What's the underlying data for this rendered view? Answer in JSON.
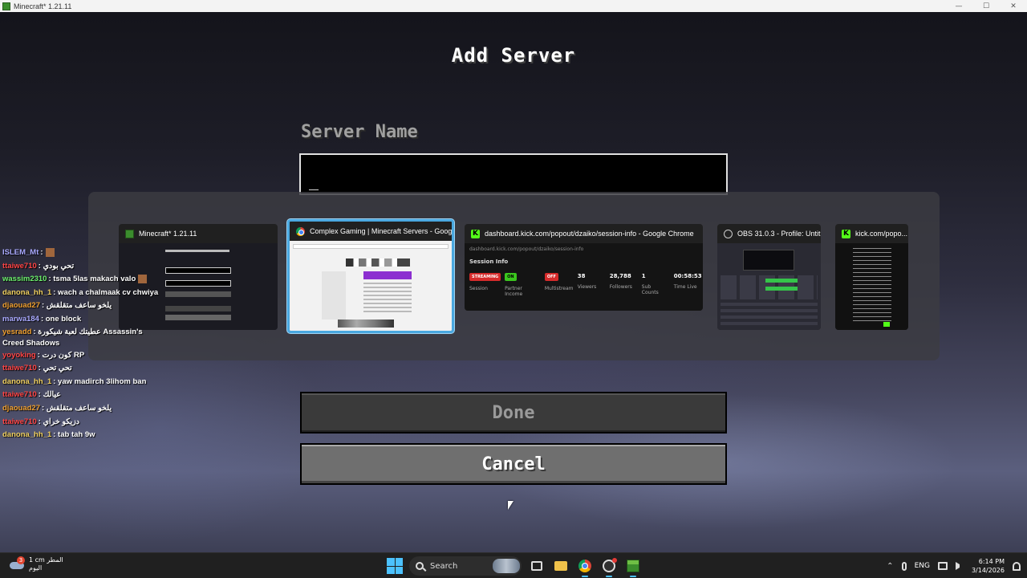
{
  "window": {
    "title": "Minecraft* 1.21.11",
    "controls": [
      "—",
      "☐",
      "✕"
    ]
  },
  "screen": {
    "title": "Add Server",
    "server_name_label": "Server Name",
    "server_name_value": "_",
    "done_label": "Done",
    "cancel_label": "Cancel"
  },
  "switcher": {
    "windows": [
      {
        "label": "Minecraft* 1.21.11",
        "icon": "minecraft-icon"
      },
      {
        "label": "Complex Gaming | Minecraft Servers - Googl...",
        "icon": "chrome-icon",
        "selected": true
      },
      {
        "label": "dashboard.kick.com/popout/dzaiko/session-info - Google Chrome",
        "icon": "kick-icon"
      },
      {
        "label": "OBS 31.0.3 - Profile: Untitl...",
        "icon": "obs-icon"
      },
      {
        "label": "kick.com/popo...",
        "icon": "kick-icon"
      }
    ],
    "session": {
      "url": "dashboard.kick.com/popout/dzaiko/session-info",
      "heading": "Session Info",
      "session_pill": "STREAMING",
      "session_caption": "Session",
      "partner_pill": "ON",
      "partner_caption": "Partner Income",
      "multistream_pill": "OFF",
      "multistream_caption": "Multistream",
      "viewers": "38",
      "viewers_caption": "Viewers",
      "followers": "28,788",
      "followers_caption": "Followers",
      "subs": "1",
      "subs_caption": "Sub Counts",
      "time_live": "00:58:53",
      "time_live_caption": "Time Live"
    }
  },
  "chat": [
    {
      "user": "ISLEM_Mt",
      "user_color": "#a9a9ff",
      "message": ":",
      "emote": true
    },
    {
      "user": "ttaiwe710",
      "user_color": "#ff4444",
      "message": ": تحي بودي"
    },
    {
      "user": "wassim2310",
      "user_color": "#6cf06c",
      "message": ": tsma 5las makach valo",
      "emote": true
    },
    {
      "user": "danona_hh_1",
      "user_color": "#f0d060",
      "message": ": wach a chalmaak cv chwiya"
    },
    {
      "user": "djaouad27",
      "user_color": "#f0a030",
      "message": ": يلخو ساعف متقلقش"
    },
    {
      "user": "marwa184",
      "user_color": "#a9a9ff",
      "message": ": one block"
    },
    {
      "user": "yesradd",
      "user_color": "#f0a030",
      "message": ": عطيتك لعبة شيكورة Assassin's Creed Shadows",
      "wrap": true
    },
    {
      "user": "yoyoking",
      "user_color": "#ff4444",
      "message": ": كون درت RP"
    },
    {
      "user": "ttaiwe710",
      "user_color": "#ff4444",
      "message": ": تحي تحي"
    },
    {
      "user": "danona_hh_1",
      "user_color": "#f0d060",
      "message": ": yaw madirch 3lihom ban"
    },
    {
      "user": "ttaiwe710",
      "user_color": "#ff4444",
      "message": ": عيالك"
    },
    {
      "user": "djaouad27",
      "user_color": "#f0a030",
      "message": ": يلخو ساعف متقلقش"
    },
    {
      "user": "ttaiwe710",
      "user_color": "#ff4444",
      "message": ": دزيكو خراي"
    },
    {
      "user": "danona_hh_1",
      "user_color": "#f0d060",
      "message": ": tab tah 9w"
    }
  ],
  "taskbar": {
    "weather_badge": "3",
    "weather_temp": "1 cm المطر",
    "weather_day": "اليوم",
    "search_label": "Search",
    "language": "ENG",
    "time": "6:14 PM",
    "date": "3/14/2026"
  },
  "colors": {
    "selected_outline": "#4aa8e0",
    "kick_green": "#53fc18"
  }
}
